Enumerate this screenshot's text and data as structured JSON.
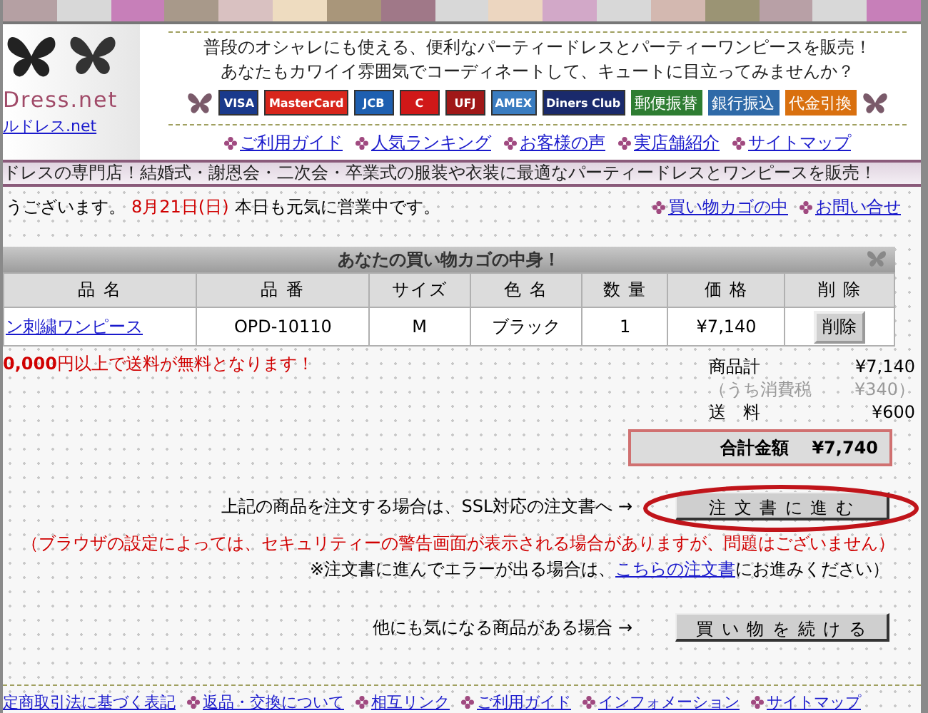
{
  "logo": {
    "title": "Dress.net",
    "subtitle": "ルドレス.net"
  },
  "taglines": [
    "普段のオシャレにも使える、便利なパーティードレスとパーティーワンピースを販売！",
    "あなたもカワイイ雰囲気でコーディネートして、キュートに目立ってみませんか？"
  ],
  "payment_methods": [
    {
      "label": "VISA",
      "kind": "card",
      "color": "#1a3a8c"
    },
    {
      "label": "MasterCard",
      "kind": "card",
      "color": "#d8261c"
    },
    {
      "label": "JCB",
      "kind": "card",
      "color": "#1e5fb0"
    },
    {
      "label": "C",
      "kind": "card",
      "color": "#d01818"
    },
    {
      "label": "UFJ",
      "kind": "card",
      "color": "#a01818"
    },
    {
      "label": "AMEX",
      "kind": "card",
      "color": "#3a7cc0"
    },
    {
      "label": "Diners Club",
      "kind": "card",
      "color": "#1a2a6c"
    },
    {
      "label": "郵便振替",
      "kind": "transfer",
      "color": "#2e7d32"
    },
    {
      "label": "銀行振込",
      "kind": "transfer",
      "color": "#2f6aa8"
    },
    {
      "label": "代金引換",
      "kind": "transfer",
      "color": "#d9700f"
    }
  ],
  "nav_links": [
    "ご利用ガイド",
    "人気ランキング",
    "お客様の声",
    "実店舗紹介",
    "サイトマップ"
  ],
  "banner": "ドレスの専門店！結婚式・謝恩会・二次会・卒業式の服装や衣装に最適なパーティードレスとワンピースを販売！",
  "greeting": {
    "start": "うございます。",
    "date": "8月21日(日)",
    "end": "本日も元気に営業中です。"
  },
  "header_links": [
    "買い物カゴの中",
    "お問い合せ"
  ],
  "cart": {
    "title": "あなたの買い物カゴの中身！",
    "columns": [
      "品 名",
      "品 番",
      "サイズ",
      "色 名",
      "数 量",
      "価 格",
      "削 除"
    ],
    "rows": [
      {
        "name": "ン刺繍ワンピース",
        "code": "OPD-10110",
        "size": "M",
        "color_name": "ブラック",
        "quantity": "1",
        "price": "¥7,140",
        "delete": "削除"
      }
    ]
  },
  "shipping_note": "**0,000**円以上で送料が無料となります！",
  "summary": [
    {
      "label": "商品計",
      "value": "¥7,140",
      "kind": "normal"
    },
    {
      "label": "（うち消費税",
      "value": "¥340）",
      "kind": "muted"
    },
    {
      "label": "送　料",
      "value": "¥600",
      "kind": "normal"
    }
  ],
  "total": {
    "label": "合計金額",
    "value": "¥7,740"
  },
  "order": {
    "text": "上記の商品を注文する場合は、SSL対応の注文書へ →",
    "button": "注 文 書 に 進 む",
    "warning": "（ブラウザの設定によっては、セキュリティーの警告画面が表示される場合がありますが、問題はございません）",
    "alt_before": "※注文書に進んでエラーが出る場合は、",
    "alt_link": "こちらの注文書",
    "alt_after": "にお進みください）"
  },
  "continue": {
    "text": "他にも気になる商品がある場合 →",
    "button": "買 い 物 を 続 け る"
  },
  "footer_links": [
    "定商取引法に基づく表記",
    "返品・交換について",
    "相互リンク",
    "ご利用ガイド",
    "インフォメーション",
    "サイトマップ"
  ]
}
